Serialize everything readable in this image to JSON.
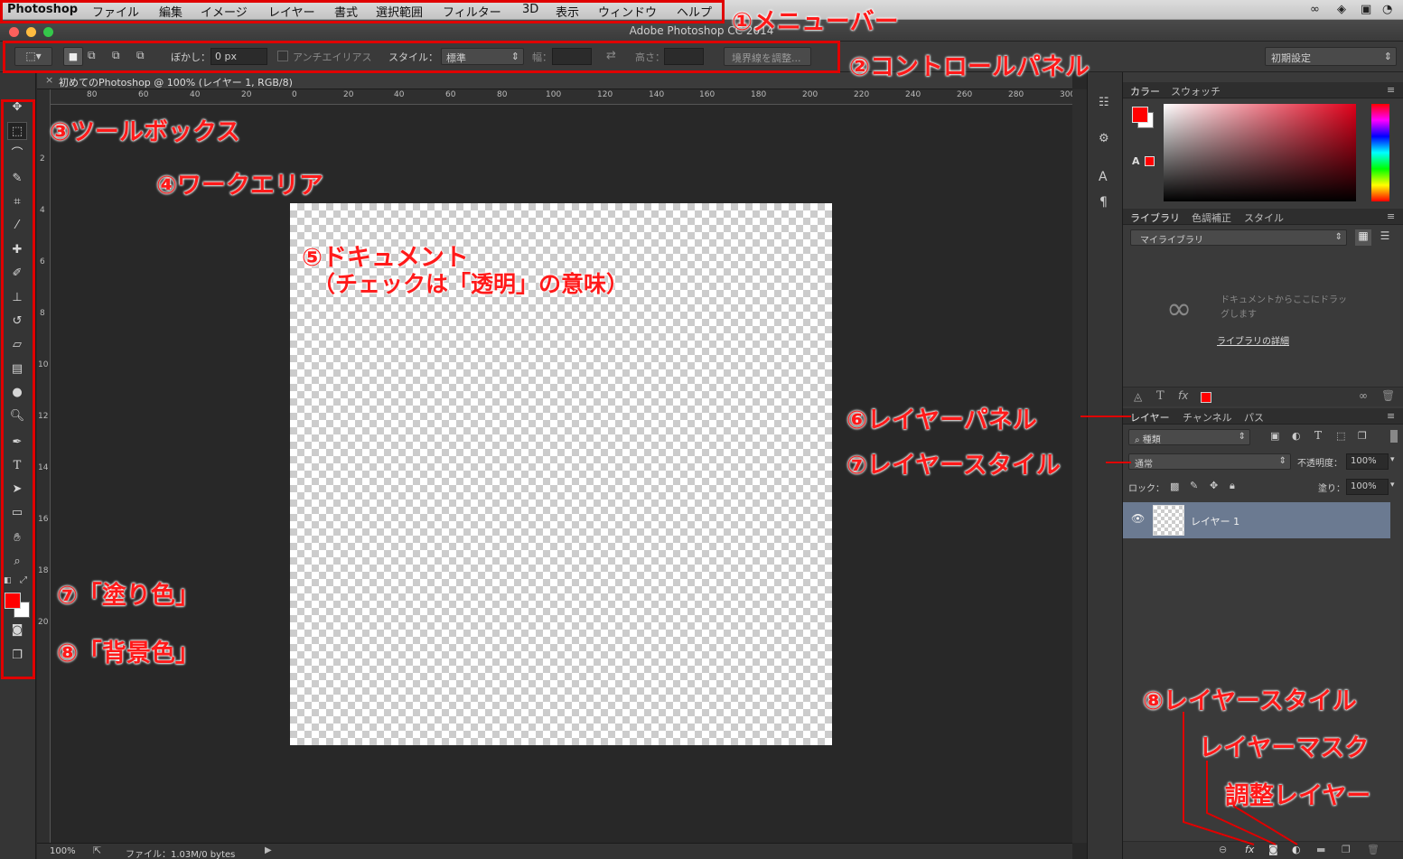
{
  "menubar": {
    "app": "Photoshop",
    "items": [
      "ファイル",
      "編集",
      "イメージ",
      "レイヤー",
      "書式",
      "選択範囲",
      "フィルター",
      "3D",
      "表示",
      "ウィンドウ",
      "ヘルプ"
    ]
  },
  "window": {
    "title": "Adobe Photoshop CC 2014"
  },
  "options": {
    "feather_label": "ぼかし：",
    "feather_value": "0 px",
    "antialias_label": "アンチエイリアス",
    "style_label": "スタイル：",
    "style_value": "標準",
    "width_label": "幅：",
    "height_label": "高さ：",
    "refine_button": "境界線を調整...",
    "workspace": "初期設定"
  },
  "document": {
    "tab_title": "初めてのPhotoshop @ 100% (レイヤー 1, RGB/8)",
    "zoom": "100%",
    "file_info": "ファイル：1.03M/0 bytes"
  },
  "ruler": {
    "h": [
      "80",
      "60",
      "40",
      "20",
      "0",
      "20",
      "40",
      "60",
      "80",
      "100",
      "120",
      "140",
      "160",
      "180",
      "200",
      "220",
      "240",
      "260",
      "280",
      "300"
    ],
    "v": [
      "2",
      "4",
      "6",
      "8",
      "10",
      "12",
      "14",
      "16",
      "18",
      "20"
    ]
  },
  "panels": {
    "color_tabs": [
      "カラー",
      "スウォッチ"
    ],
    "library_tabs": [
      "ライブラリ",
      "色調補正",
      "スタイル"
    ],
    "library_select": "マイライブラリ",
    "library_drop_text": "ドキュメントからここにドラッグします",
    "library_details": "ライブラリの詳細",
    "layer_tabs": [
      "レイヤー",
      "チャンネル",
      "パス"
    ],
    "layer_filter": "種類",
    "blend_mode": "通常",
    "opacity_label": "不透明度：",
    "opacity_value": "100%",
    "lock_label": "ロック：",
    "fill_label": "塗り：",
    "fill_value": "100%",
    "layer_name": "レイヤー 1"
  },
  "colors": {
    "foreground": "#ff0000",
    "background": "#ffffff",
    "accent_annotation": "#e00000"
  },
  "annotations": {
    "a1": "①メニューバー",
    "a2": "②コントロールパネル",
    "a3": "③ツールボックス",
    "a4": "④ワークエリア",
    "a5_line1": "⑤ドキュメント",
    "a5_line2": "（チェックは「透明」の意味）",
    "a6": "⑥レイヤーパネル",
    "a7_layer": "⑦レイヤースタイル",
    "a7_fill": "⑦「塗り色」",
    "a8_bg": "⑧「背景色」",
    "a8_style": "⑧レイヤースタイル",
    "layer_mask": "レイヤーマスク",
    "adjust_layer": "調整レイヤー"
  }
}
